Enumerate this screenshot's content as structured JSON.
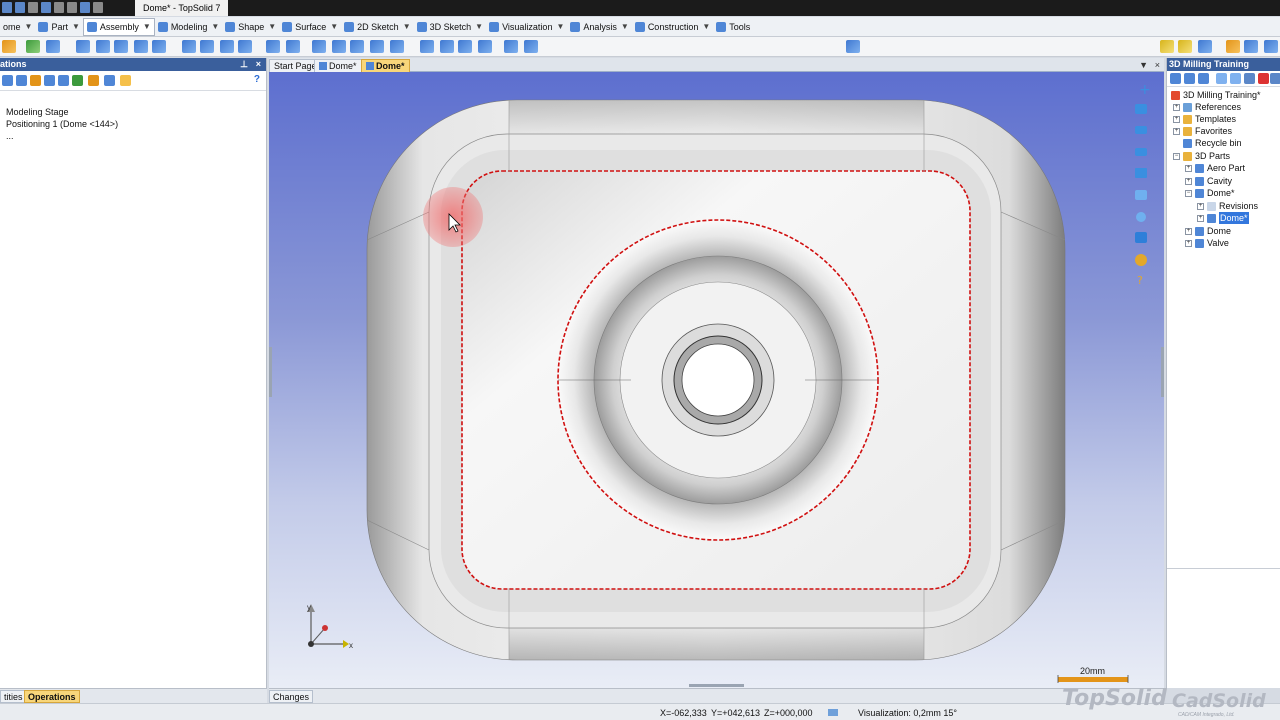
{
  "window": {
    "title": "Dome* - TopSolid 7"
  },
  "ribbon": {
    "tabs": [
      {
        "label": "ome",
        "active": false
      },
      {
        "label": "Part",
        "active": false
      },
      {
        "label": "Assembly",
        "active": true
      },
      {
        "label": "Modeling",
        "active": false
      },
      {
        "label": "Shape",
        "active": false
      },
      {
        "label": "Surface",
        "active": false
      },
      {
        "label": "2D Sketch",
        "active": false
      },
      {
        "label": "3D Sketch",
        "active": false
      },
      {
        "label": "Visualization",
        "active": false
      },
      {
        "label": "Analysis",
        "active": false
      },
      {
        "label": "Construction",
        "active": false
      },
      {
        "label": "Tools",
        "active": false
      }
    ]
  },
  "left_panel": {
    "title": "ations",
    "pin_icon": "⊥",
    "close_icon": "×",
    "help_icon": "?",
    "tree": [
      "Modeling Stage",
      "Positioning 1 (Dome <144>)",
      "..."
    ]
  },
  "doc_tabs": {
    "tabs": [
      {
        "label": "Start Page",
        "active": false
      },
      {
        "label": "Dome*",
        "active": false
      },
      {
        "label": "Dome*",
        "active": true
      }
    ],
    "menu_icon": "▼",
    "close_icon": "×"
  },
  "viewport": {
    "axis_x": "x",
    "axis_y": "y",
    "scale_label": "20mm",
    "colors": {
      "highlight": "#d01010",
      "cursor_halo": "#f07070"
    }
  },
  "right_panel": {
    "title": "3D Milling Training",
    "nodes": [
      {
        "label": "3D Milling Training*",
        "depth": 0,
        "expander": ""
      },
      {
        "label": "References",
        "depth": 0,
        "expander": "+"
      },
      {
        "label": "Templates",
        "depth": 0,
        "expander": "+"
      },
      {
        "label": "Favorites",
        "depth": 0,
        "expander": "+"
      },
      {
        "label": "Recycle bin",
        "depth": 0,
        "expander": ""
      },
      {
        "label": "3D Parts",
        "depth": 0,
        "expander": "−"
      },
      {
        "label": "Aero Part",
        "depth": 1,
        "expander": "+"
      },
      {
        "label": "Cavity",
        "depth": 1,
        "expander": "+"
      },
      {
        "label": "Dome*",
        "depth": 1,
        "expander": "−"
      },
      {
        "label": "Revisions",
        "depth": 2,
        "expander": "+"
      },
      {
        "label": "Dome*",
        "depth": 2,
        "expander": "+",
        "selected": true
      },
      {
        "label": "Dome",
        "depth": 1,
        "expander": "+"
      },
      {
        "label": "Valve",
        "depth": 1,
        "expander": "+"
      }
    ]
  },
  "bottom_left_tabs": [
    {
      "label": "tities",
      "active": false
    },
    {
      "label": "Operations",
      "active": true
    }
  ],
  "bottom_center_tabs": [
    {
      "label": "Changes",
      "active": false
    }
  ],
  "status": {
    "x": "X=-062,333",
    "y": "Y=+042,613",
    "z": "Z=+000,000",
    "visualization": "Visualization: 0,2mm 15°"
  },
  "branding": {
    "topsolid": "TopSolid",
    "cadsolid": "CadSolid",
    "cadsolid_sub": "CAD/CAM Integrado, Ltd."
  }
}
